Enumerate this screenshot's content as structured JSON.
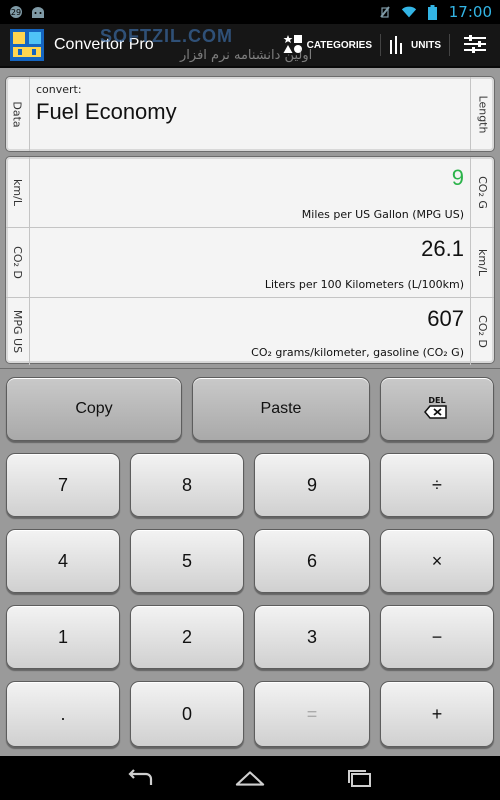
{
  "status_bar": {
    "time": "17:00",
    "left_icons": [
      "notification-icon",
      "android-icon"
    ],
    "right_icons": [
      "no-sim-icon",
      "wifi-icon",
      "battery-icon"
    ]
  },
  "action_bar": {
    "title": "Convertor Pro",
    "watermark": "SOFTZIL.COM",
    "watermark_sub": "اولین دانشنامه نرم افزار",
    "categories_label": "CATEGORIES",
    "units_label": "UNITS"
  },
  "convert_panel": {
    "left_label": "Data",
    "right_label": "Length",
    "caption": "convert:",
    "category": "Fuel Economy"
  },
  "conversions": [
    {
      "left_label": "km/L",
      "right_label": "CO₂ G",
      "value": "9",
      "unit": "Miles per US Gallon (MPG US)",
      "active": true
    },
    {
      "left_label": "CO₂ D",
      "right_label": "km/L",
      "value": "26.1",
      "unit": "Liters per 100 Kilometers (L/100km)",
      "active": false
    },
    {
      "left_label": "MPG US",
      "right_label": "CO₂ D",
      "value": "607",
      "unit": "CO₂ grams/kilometer, gasoline (CO₂ G)",
      "active": false
    }
  ],
  "keypad": {
    "copy": "Copy",
    "paste": "Paste",
    "del": "DEL",
    "rows": [
      [
        "7",
        "8",
        "9",
        "÷"
      ],
      [
        "4",
        "5",
        "6",
        "×"
      ],
      [
        "1",
        "2",
        "3",
        "−"
      ],
      [
        ".",
        "0",
        "=",
        "+"
      ]
    ]
  },
  "colors": {
    "active_value": "#2bb34a",
    "accent": "#33b5e5",
    "background": "#9a9a9a"
  }
}
